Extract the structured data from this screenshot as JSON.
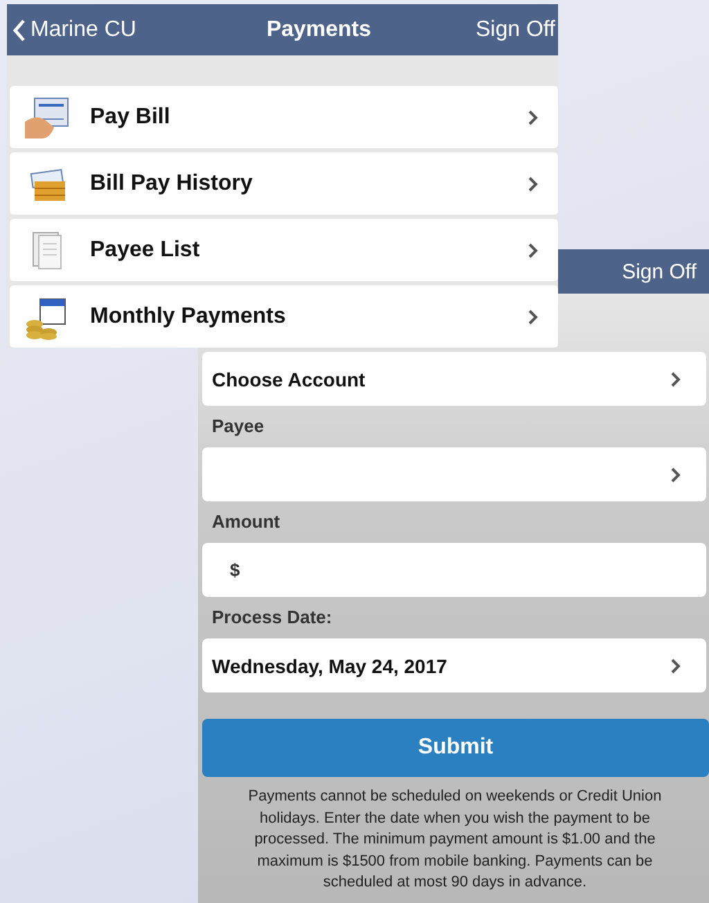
{
  "screens": [
    {
      "nav": {
        "back_label": "Marine CU",
        "title": "Payments",
        "action": "Sign Off"
      },
      "menu": [
        {
          "label": "Pay Bill"
        },
        {
          "label": "Bill Pay History"
        },
        {
          "label": "Payee List"
        },
        {
          "label": "Monthly Payments"
        }
      ]
    },
    {
      "nav": {
        "action": "Sign Off"
      },
      "form": [
        {
          "kind": "select",
          "value": "Choose Account"
        },
        {
          "kind": "label",
          "text": "Payee"
        },
        {
          "kind": "select"
        },
        {
          "kind": "label",
          "text": "Amount"
        },
        {
          "kind": "input",
          "prefix": "$"
        },
        {
          "kind": "label",
          "text": "Process Date:"
        },
        {
          "kind": "select",
          "value": "Wednesday, May 24, 2017"
        }
      ],
      "submit": "Submit",
      "note": "Payments cannot be scheduled on weekends or Credit Union holidays. Enter the date when you wish the payment to be processed. The minimum payment amount is $1.00 and the maximum is $1500 from mobile banking. Payments can be scheduled at most 90 days in advance."
    }
  ]
}
